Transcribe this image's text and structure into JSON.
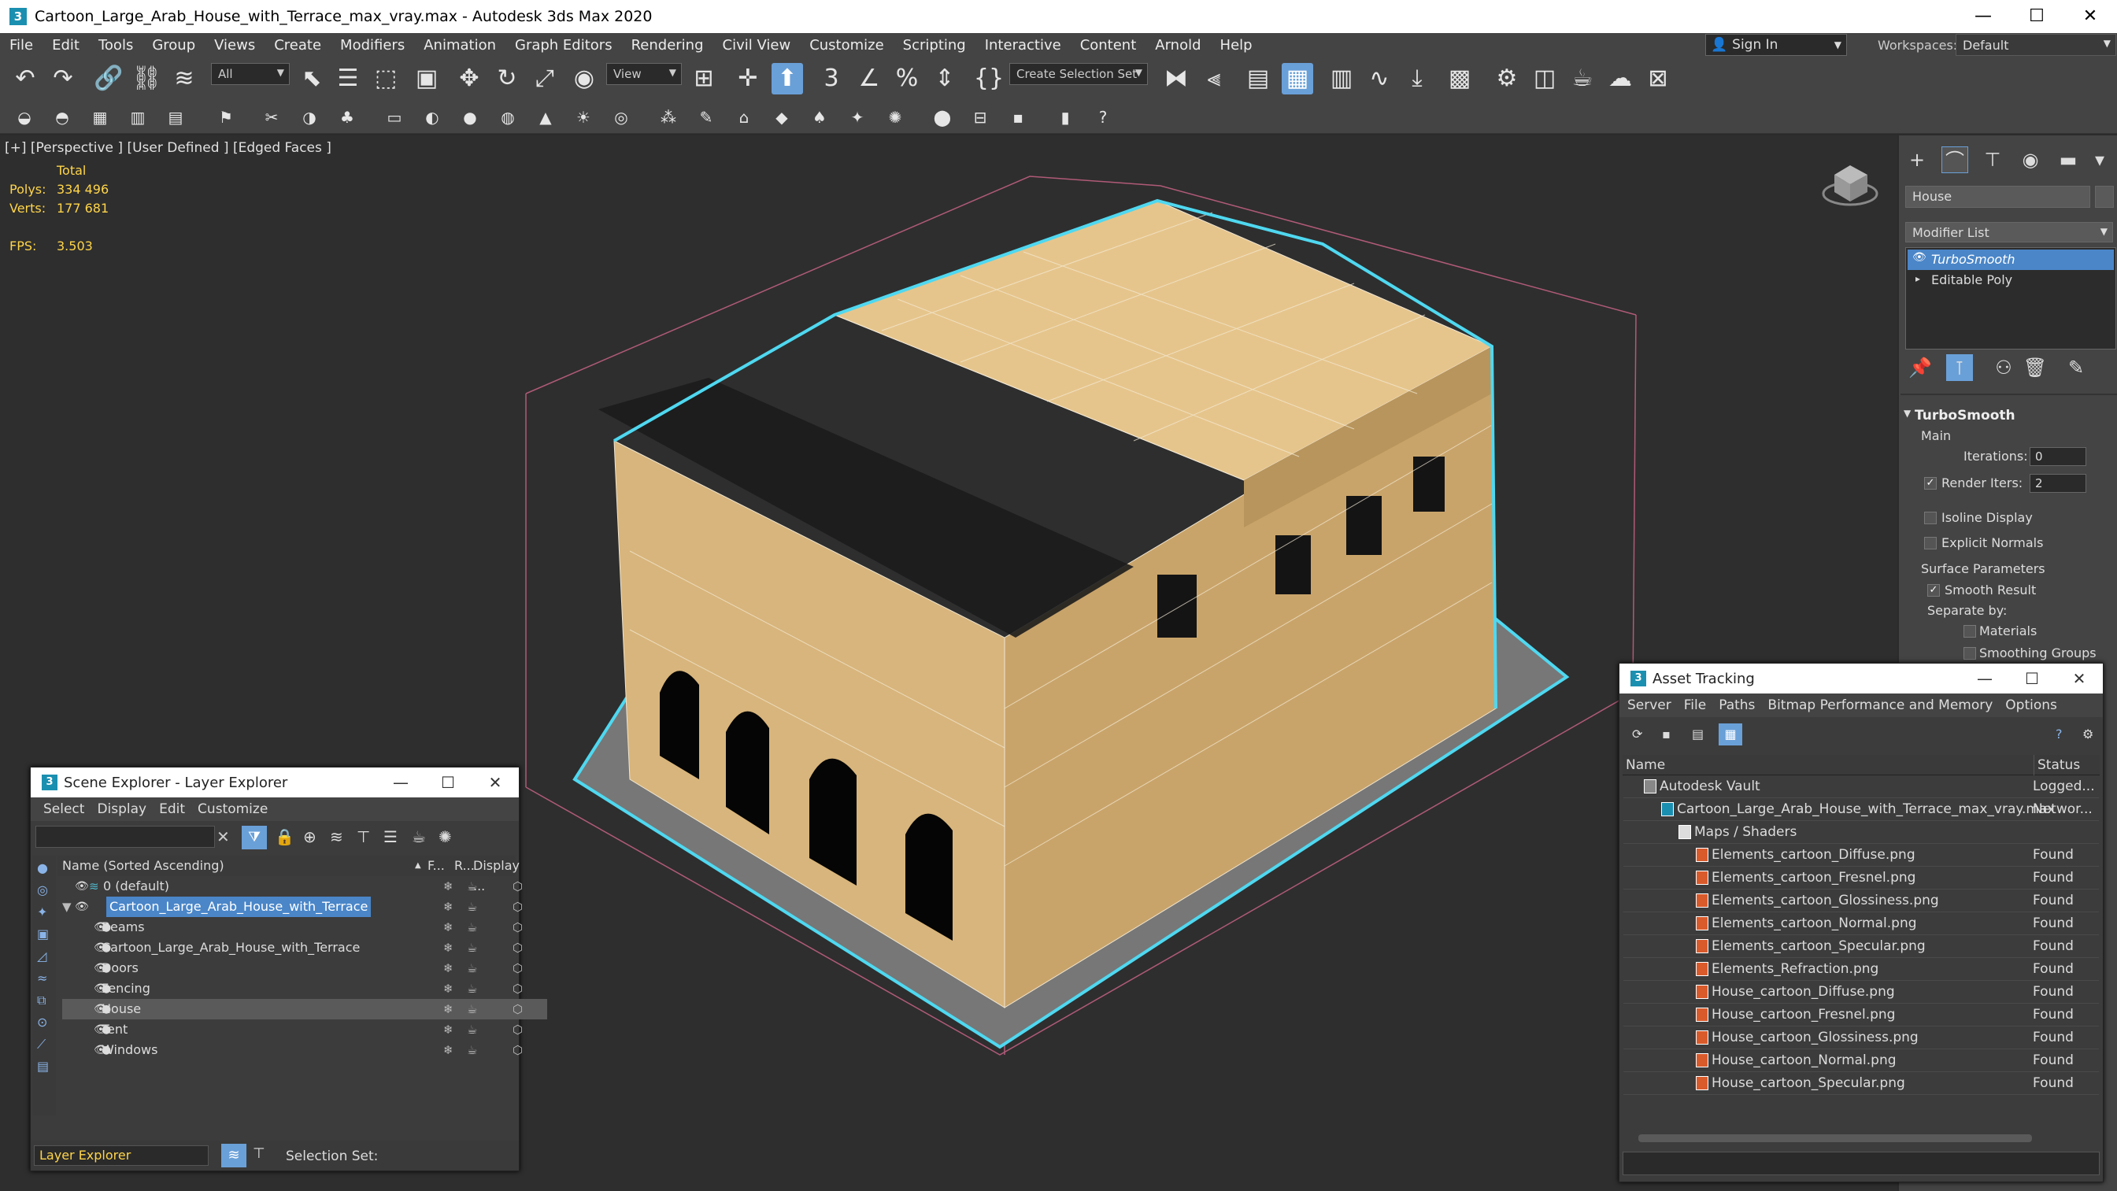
{
  "window": {
    "title": "Cartoon_Large_Arab_House_with_Terrace_max_vray.max - Autodesk 3ds Max 2020",
    "minimize": "—",
    "maximize": "☐",
    "close": "✕"
  },
  "menu": [
    "File",
    "Edit",
    "Tools",
    "Group",
    "Views",
    "Create",
    "Modifiers",
    "Animation",
    "Graph Editors",
    "Rendering",
    "Civil View",
    "Customize",
    "Scripting",
    "Interactive",
    "Content",
    "Arnold",
    "Help"
  ],
  "signin": {
    "label": "Sign In",
    "icon": "user-icon"
  },
  "workspaces": {
    "label": "Workspaces:",
    "value": "Default"
  },
  "toolbar": {
    "filter": "All",
    "refcoord": "View",
    "selection_set": "Create Selection Set"
  },
  "viewport": {
    "label": "[+] [Perspective ] [User Defined ] [Edged Faces ]",
    "stats": {
      "total_label": "Total",
      "polys_label": "Polys:",
      "polys": "334 496",
      "verts_label": "Verts:",
      "verts": "177 681",
      "fps_label": "FPS:",
      "fps": "3.503"
    }
  },
  "command_panel": {
    "object_name": "House",
    "modifier_list": "Modifier List",
    "stack": [
      "TurboSmooth",
      "Editable Poly"
    ],
    "rollout_title": "TurboSmooth",
    "main_label": "Main",
    "iterations_label": "Iterations:",
    "iterations": "0",
    "render_iters_label": "Render Iters:",
    "render_iters": "2",
    "isoline": "Isoline Display",
    "explicit_normals": "Explicit Normals",
    "surface_params": "Surface Parameters",
    "smooth_result": "Smooth Result",
    "separate_by": "Separate by:",
    "materials": "Materials",
    "smoothing_groups": "Smoothing Groups"
  },
  "scene_explorer": {
    "title": "Scene Explorer - Layer Explorer",
    "menu": [
      "Select",
      "Display",
      "Edit",
      "Customize"
    ],
    "col_name": "Name (Sorted Ascending)",
    "col_f": "F...",
    "col_r": "R...",
    "col_display": "Display ...",
    "rows": [
      {
        "name": "0 (default)",
        "indent": 0
      },
      {
        "name": "Cartoon_Large_Arab_House_with_Terrace",
        "indent": 0
      },
      {
        "name": "Beams",
        "indent": 1
      },
      {
        "name": "Cartoon_Large_Arab_House_with_Terrace",
        "indent": 1
      },
      {
        "name": "Doors",
        "indent": 1
      },
      {
        "name": "Fencing",
        "indent": 1
      },
      {
        "name": "House",
        "indent": 1
      },
      {
        "name": "Tent",
        "indent": 1
      },
      {
        "name": "Windows",
        "indent": 1
      }
    ],
    "footer_combo": "Layer Explorer",
    "selection_set_label": "Selection Set:"
  },
  "asset_tracking": {
    "title": "Asset Tracking",
    "menu": [
      "Server",
      "File",
      "Paths",
      "Bitmap Performance and Memory",
      "Options"
    ],
    "col_name": "Name",
    "col_status": "Status",
    "rows": [
      {
        "name": "Autodesk Vault",
        "status": "Logged...",
        "level": 0
      },
      {
        "name": "Cartoon_Large_Arab_House_with_Terrace_max_vray.max",
        "status": "Networ...",
        "level": 1
      },
      {
        "name": "Maps / Shaders",
        "status": "",
        "level": 2
      },
      {
        "name": "Elements_cartoon_Diffuse.png",
        "status": "Found",
        "level": 3
      },
      {
        "name": "Elements_cartoon_Fresnel.png",
        "status": "Found",
        "level": 3
      },
      {
        "name": "Elements_cartoon_Glossiness.png",
        "status": "Found",
        "level": 3
      },
      {
        "name": "Elements_cartoon_Normal.png",
        "status": "Found",
        "level": 3
      },
      {
        "name": "Elements_cartoon_Specular.png",
        "status": "Found",
        "level": 3
      },
      {
        "name": "Elements_Refraction.png",
        "status": "Found",
        "level": 3
      },
      {
        "name": "House_cartoon_Diffuse.png",
        "status": "Found",
        "level": 3
      },
      {
        "name": "House_cartoon_Fresnel.png",
        "status": "Found",
        "level": 3
      },
      {
        "name": "House_cartoon_Glossiness.png",
        "status": "Found",
        "level": 3
      },
      {
        "name": "House_cartoon_Normal.png",
        "status": "Found",
        "level": 3
      },
      {
        "name": "House_cartoon_Specular.png",
        "status": "Found",
        "level": 3
      }
    ]
  }
}
